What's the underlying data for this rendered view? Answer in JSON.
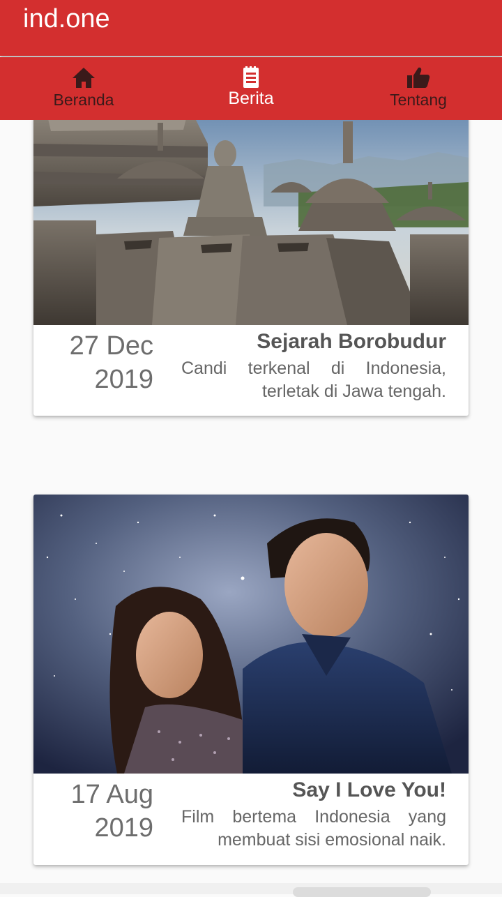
{
  "app": {
    "title": "ind.one",
    "colors": {
      "primary": "#d32f2f",
      "tab_inactive": "#3a1a1a",
      "tab_active": "#ffffff",
      "background": "#fafafa"
    }
  },
  "tabs": [
    {
      "label": "Beranda",
      "icon": "home-icon",
      "active": false
    },
    {
      "label": "Berita",
      "icon": "news-icon",
      "active": true
    },
    {
      "label": "Tentang",
      "icon": "thumbs-up-icon",
      "active": false
    }
  ],
  "articles": [
    {
      "image": "borobudur-temple-photo",
      "date": "27 Dec 2019",
      "title": "Sejarah Borobudur",
      "description": "Candi terkenal di Indonesia, terletak di Jawa tengah."
    },
    {
      "image": "say-i-love-you-movie-poster",
      "date": "17 Aug 2019",
      "title": "Say I Love You!",
      "description": "Film bertema Indonesia yang membuat sisi emosional naik."
    }
  ]
}
